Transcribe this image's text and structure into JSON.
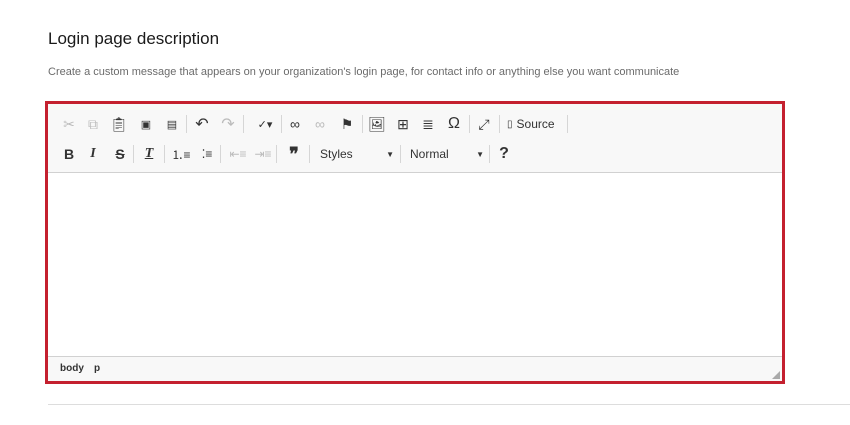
{
  "section": {
    "title": "Login page description",
    "description": "Create a custom message that appears on your organization's login page, for contact info or anything else you want communicate"
  },
  "toolbar": {
    "icons_row1": [
      "cut-icon",
      "copy-icon",
      "paste-icon",
      "paste-text-icon",
      "paste-word-icon",
      "undo-icon",
      "redo-icon",
      "spellcheck-icon",
      "link-icon",
      "unlink-icon",
      "anchor-icon",
      "image-icon",
      "table-icon",
      "horizontal-rule-icon",
      "special-char-icon",
      "maximize-icon",
      "source-icon"
    ],
    "source_label": "Source",
    "icons_row2": [
      "bold-icon",
      "italic-icon",
      "strike-icon",
      "remove-format-icon",
      "numbered-list-icon",
      "bulleted-list-icon",
      "outdent-icon",
      "indent-icon",
      "blockquote-icon",
      "help-icon"
    ],
    "styles_value": "Styles",
    "format_value": "Normal",
    "glyphs": {
      "bold": "B",
      "italic": "I",
      "strike": "S",
      "removeformat": "T",
      "help": "?",
      "omega": "Ω",
      "quote": "❞"
    }
  },
  "statusbar": {
    "path": [
      "body",
      "p"
    ]
  },
  "colors": {
    "accent": "#c4202f"
  }
}
